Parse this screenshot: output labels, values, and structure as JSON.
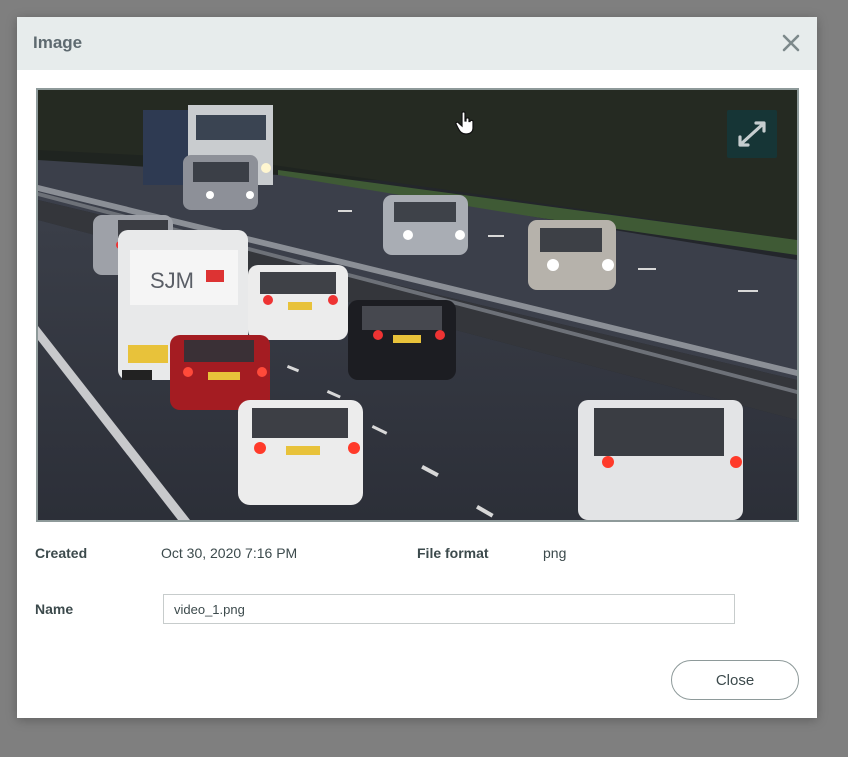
{
  "dialog": {
    "title": "Image",
    "close_icon": "close-icon",
    "expand_icon": "expand-icon"
  },
  "image": {
    "van_text": "SJM"
  },
  "meta": {
    "created_label": "Created",
    "created_value": "Oct 30, 2020 7:16 PM",
    "format_label": "File format",
    "format_value": "png",
    "name_label": "Name",
    "name_value": "video_1.png"
  },
  "footer": {
    "close_label": "Close"
  },
  "colors": {
    "header_bg": "#e7ecec",
    "overlay": "#7f7f7f",
    "text": "#3c4a4c"
  }
}
